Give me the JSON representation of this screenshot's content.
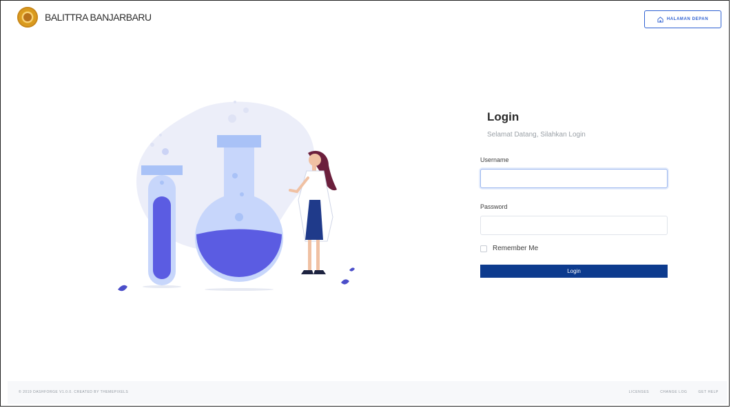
{
  "navbar": {
    "brand_text": "BALITTRA BANJARBARU",
    "home_button_label": "HALAMAN DEPAN",
    "home_icon": "home-icon"
  },
  "login": {
    "title": "Login",
    "subtitle": "Selamat Datang, Silahkan Login",
    "username_label": "Username",
    "username_value": "",
    "password_label": "Password",
    "password_value": "",
    "remember_label": "Remember Me",
    "remember_checked": false,
    "submit_label": "Login"
  },
  "footer": {
    "copyright": "© 2019 DASHFORGE V1.0.0. CREATED BY THEMEPIXELS",
    "links": [
      "LICENSES",
      "CHANGE LOG",
      "GET HELP"
    ]
  },
  "colors": {
    "primary": "#0d3b8e",
    "accent": "#2c5fd1",
    "illustration_liquid": "#5b5ce2",
    "illustration_glass": "#a9c2f7"
  }
}
